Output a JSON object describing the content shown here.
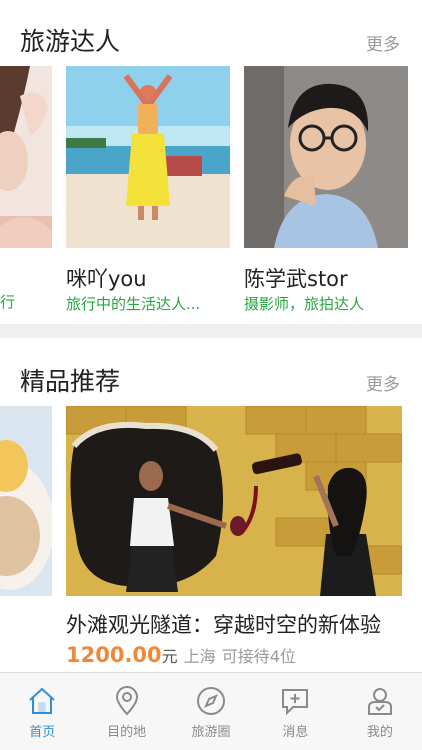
{
  "sections": {
    "experts": {
      "title": "旅游达人",
      "more": "更多",
      "cards": [
        {
          "name": "",
          "desc": "行"
        },
        {
          "name": "咪吖you",
          "desc": "旅行中的生活达人..."
        },
        {
          "name": "陈学武stor",
          "desc": "摄影师，旅拍达人"
        }
      ]
    },
    "featured": {
      "title": "精品推荐",
      "more": "更多",
      "item": {
        "title": "外滩观光隧道：穿越时空的新体验",
        "price": "1200.00",
        "unit": "元",
        "city": "上海",
        "capacity": "可接待4位"
      }
    }
  },
  "tabbar": {
    "tabs": [
      {
        "label": "首页",
        "icon": "home-icon",
        "active": true
      },
      {
        "label": "目的地",
        "icon": "location-pin-icon",
        "active": false
      },
      {
        "label": "旅游圈",
        "icon": "compass-icon",
        "active": false
      },
      {
        "label": "消息",
        "icon": "message-icon",
        "active": false
      },
      {
        "label": "我的",
        "icon": "user-icon",
        "active": false
      }
    ]
  },
  "colors": {
    "accent": "#2f8fd8",
    "green": "#2aa83c",
    "price": "#f0883a"
  }
}
